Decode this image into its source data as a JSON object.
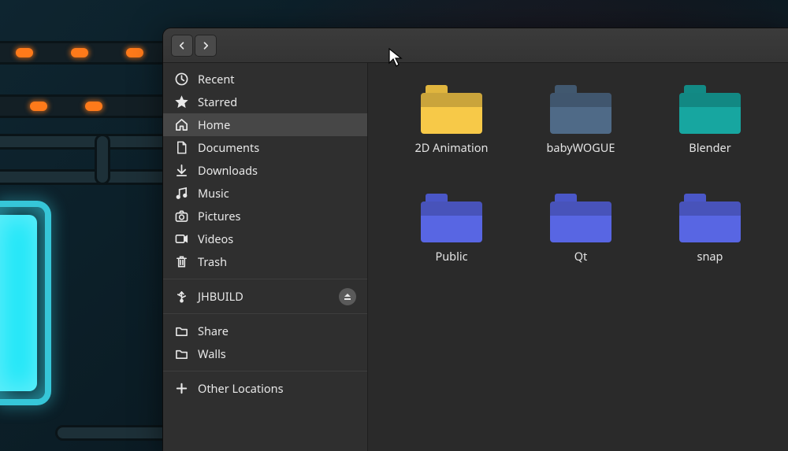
{
  "sidebar": {
    "groups": [
      [
        {
          "id": "recent",
          "label": "Recent",
          "icon": "clock"
        },
        {
          "id": "starred",
          "label": "Starred",
          "icon": "star"
        },
        {
          "id": "home",
          "label": "Home",
          "icon": "home",
          "selected": true
        },
        {
          "id": "documents",
          "label": "Documents",
          "icon": "doc"
        },
        {
          "id": "downloads",
          "label": "Downloads",
          "icon": "down"
        },
        {
          "id": "music",
          "label": "Music",
          "icon": "music"
        },
        {
          "id": "pictures",
          "label": "Pictures",
          "icon": "camera"
        },
        {
          "id": "videos",
          "label": "Videos",
          "icon": "video"
        },
        {
          "id": "trash",
          "label": "Trash",
          "icon": "trash"
        }
      ],
      [
        {
          "id": "jhbuild",
          "label": "JHBUILD",
          "icon": "usb",
          "ejectable": true
        }
      ],
      [
        {
          "id": "share",
          "label": "Share",
          "icon": "folder"
        },
        {
          "id": "walls",
          "label": "Walls",
          "icon": "folder"
        }
      ],
      [
        {
          "id": "other",
          "label": "Other Locations",
          "icon": "plus"
        }
      ]
    ]
  },
  "folders": [
    {
      "name": "2D Animation",
      "color": "#f7c948",
      "tab": "#e0b53e"
    },
    {
      "name": "babyWOGUE",
      "color": "#4f6a87",
      "tab": "#41586f"
    },
    {
      "name": "Blender",
      "color": "#17a6a0",
      "tab": "#128a85"
    },
    {
      "name": "Public",
      "color": "#5866e3",
      "tab": "#4a57c8"
    },
    {
      "name": "Qt",
      "color": "#5866e3",
      "tab": "#4a57c8"
    },
    {
      "name": "snap",
      "color": "#5866e3",
      "tab": "#4a57c8"
    }
  ]
}
